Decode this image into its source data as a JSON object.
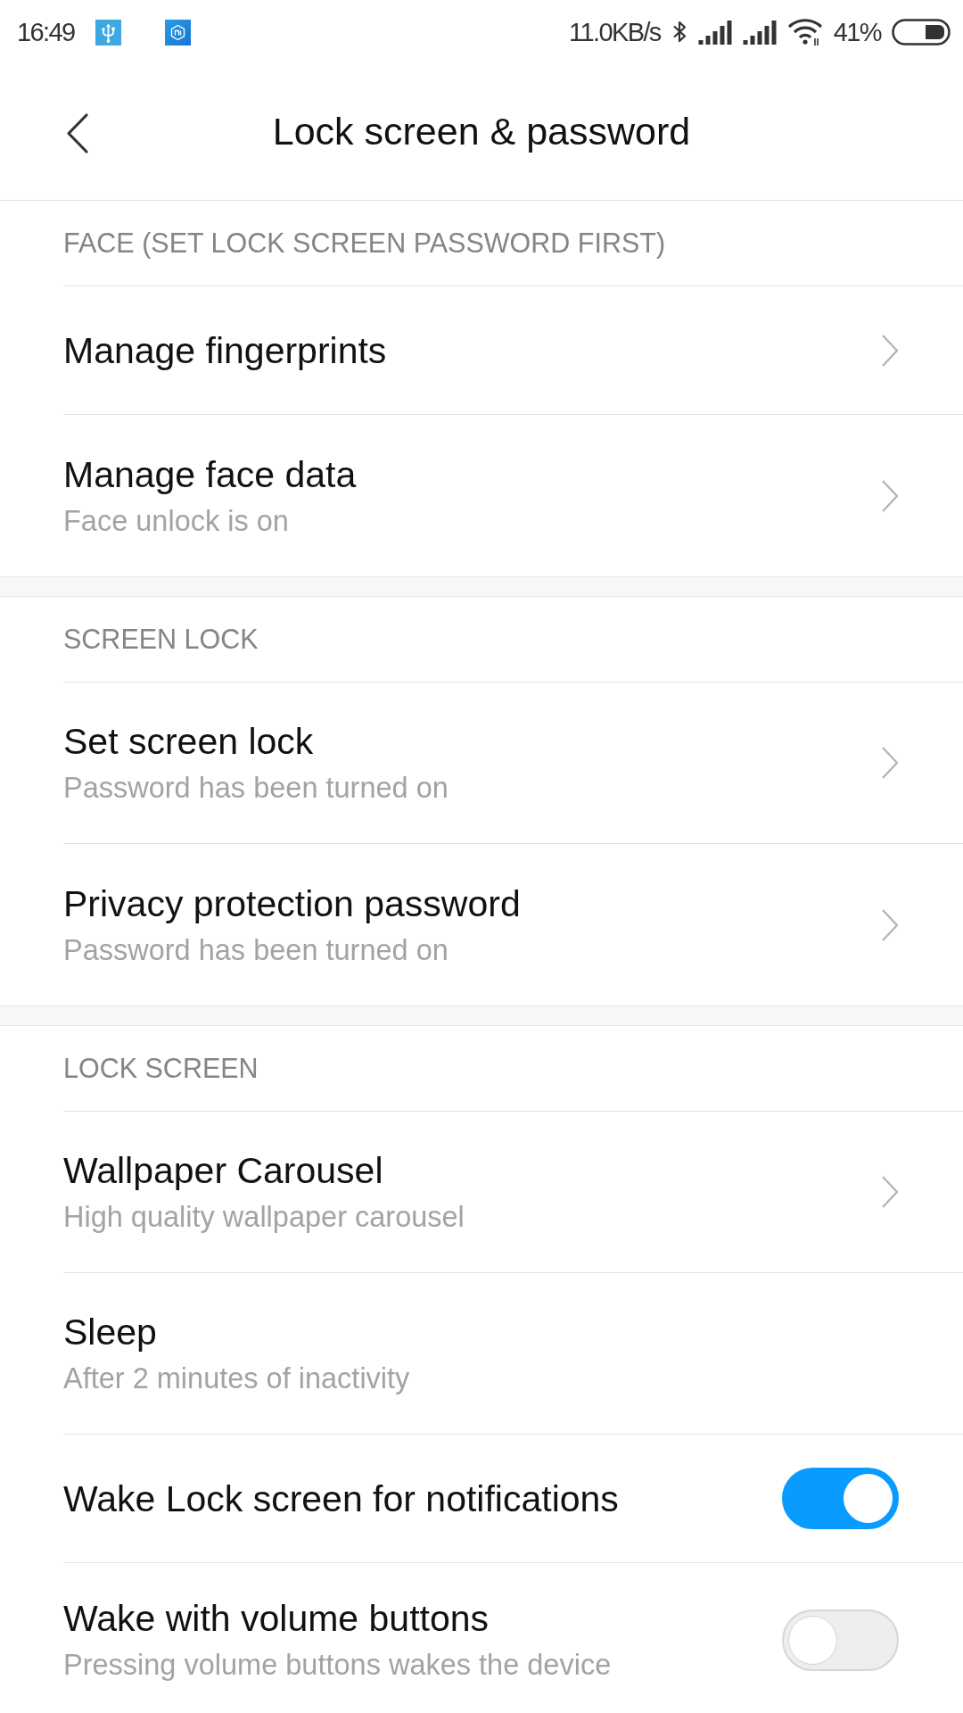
{
  "status_bar": {
    "time": "16:49",
    "network_speed": "11.0KB/s",
    "battery": "41%"
  },
  "header": {
    "title": "Lock screen & password"
  },
  "sections": [
    {
      "title": "FACE (SET LOCK SCREEN PASSWORD FIRST)",
      "items": [
        {
          "kind": "link",
          "title": "Manage fingerprints"
        },
        {
          "kind": "link",
          "title": "Manage face data",
          "subtitle": "Face unlock is on"
        }
      ]
    },
    {
      "title": "SCREEN LOCK",
      "items": [
        {
          "kind": "link",
          "title": "Set screen lock",
          "subtitle": "Password has been turned on"
        },
        {
          "kind": "link",
          "title": "Privacy protection password",
          "subtitle": "Password has been turned on"
        }
      ]
    },
    {
      "title": "LOCK SCREEN",
      "items": [
        {
          "kind": "link",
          "title": "Wallpaper Carousel",
          "subtitle": "High quality wallpaper carousel"
        },
        {
          "kind": "plain",
          "title": "Sleep",
          "subtitle": "After 2 minutes of inactivity"
        },
        {
          "kind": "toggle",
          "title": "Wake Lock screen for notifications",
          "on": true
        },
        {
          "kind": "toggle",
          "title": "Wake with volume buttons",
          "subtitle": "Pressing volume buttons wakes the device",
          "on": false
        }
      ]
    }
  ]
}
